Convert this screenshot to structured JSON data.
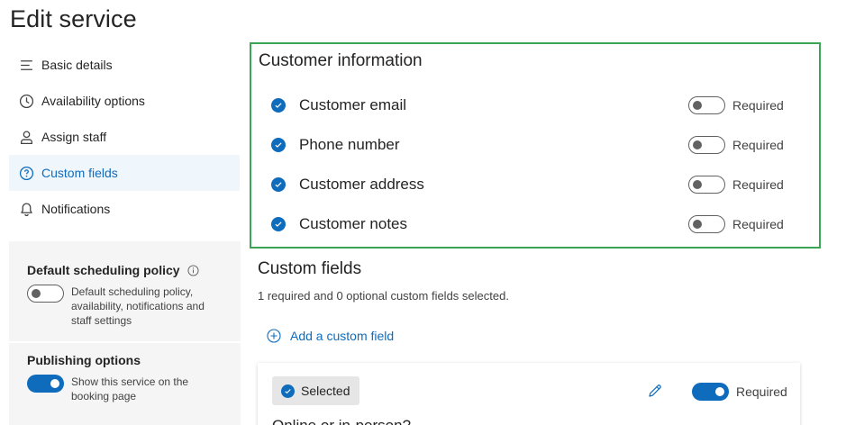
{
  "page": {
    "title": "Edit service"
  },
  "nav": {
    "items": [
      {
        "label": "Basic details",
        "icon": "lines-icon"
      },
      {
        "label": "Availability options",
        "icon": "clock-icon"
      },
      {
        "label": "Assign staff",
        "icon": "person-icon"
      },
      {
        "label": "Custom fields",
        "icon": "question-circle-icon",
        "active": true
      },
      {
        "label": "Notifications",
        "icon": "bell-icon"
      }
    ]
  },
  "policy": {
    "scheduling": {
      "title": "Default scheduling policy",
      "description": "Default scheduling policy, availability, notifications and staff settings",
      "enabled": false
    },
    "publishing": {
      "title": "Publishing options",
      "description": "Show this service on the booking page",
      "enabled": true
    }
  },
  "customer_info": {
    "title": "Customer information",
    "fields": [
      {
        "label": "Customer email",
        "checked": true,
        "required_label": "Required",
        "required": false
      },
      {
        "label": "Phone number",
        "checked": true,
        "required_label": "Required",
        "required": false
      },
      {
        "label": "Customer address",
        "checked": true,
        "required_label": "Required",
        "required": false
      },
      {
        "label": "Customer notes",
        "checked": true,
        "required_label": "Required",
        "required": false
      }
    ]
  },
  "custom_fields": {
    "title": "Custom fields",
    "summary": "1 required and 0 optional custom fields selected.",
    "add_label": "Add a custom field",
    "card": {
      "selected_label": "Selected",
      "required_label": "Required",
      "required": true,
      "question": "Online or in-person?"
    }
  },
  "colors": {
    "accent": "#0f6cbd",
    "highlight_border": "#3aa655",
    "active_nav_bg": "#eff6fc",
    "panel_bg": "#f5f5f5"
  }
}
